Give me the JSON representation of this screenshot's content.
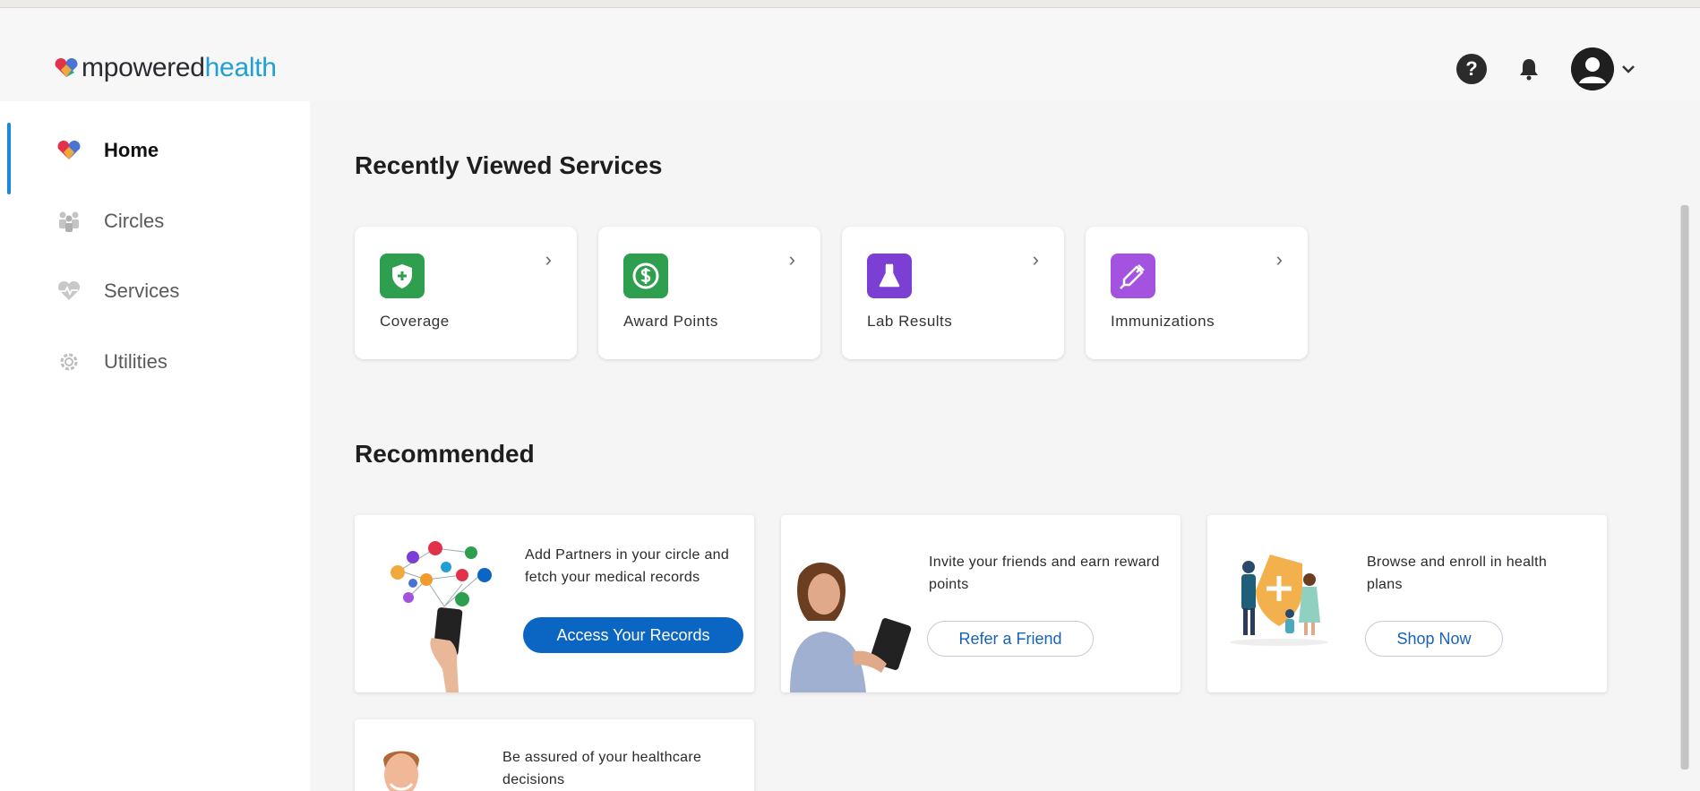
{
  "brand": {
    "part1": "mpowered",
    "part2": "health",
    "heart_colors": [
      "#e0334b",
      "#f2a93b",
      "#4a74d4",
      "#27a88e"
    ]
  },
  "header": {
    "help_glyph": "?",
    "icons": [
      "help-icon",
      "bell-icon",
      "user-avatar-icon",
      "chevron-down-icon"
    ]
  },
  "sidebar": {
    "items": [
      {
        "label": "Home",
        "icon": "heart-logo-icon",
        "active": true
      },
      {
        "label": "Circles",
        "icon": "people-icon",
        "active": false
      },
      {
        "label": "Services",
        "icon": "heart-pulse-icon",
        "active": false
      },
      {
        "label": "Utilities",
        "icon": "gear-icon",
        "active": false
      }
    ],
    "accent": "#1a8ad8"
  },
  "recent": {
    "title": "Recently Viewed Services",
    "arrow": "›",
    "items": [
      {
        "label": "Coverage",
        "icon": "shield-plus-icon",
        "color": "#2e9e4f"
      },
      {
        "label": "Award Points",
        "icon": "dollar-icon",
        "color": "#2e9e4f"
      },
      {
        "label": "Lab Results",
        "icon": "flask-icon",
        "color": "#7b3fd4"
      },
      {
        "label": "Immunizations",
        "icon": "syringe-icon",
        "color": "#a353e0"
      }
    ]
  },
  "recommended": {
    "title": "Recommended",
    "cards": [
      {
        "text": "Add Partners in your circle and fetch your medical records",
        "button": "Access Your Records",
        "style": "primary"
      },
      {
        "text": "Invite your friends and earn reward points",
        "button": "Refer a Friend",
        "style": "outline"
      },
      {
        "text": "Browse and enroll in health plans",
        "button": "Shop Now",
        "style": "outline"
      },
      {
        "text": "Be assured of your healthcare decisions"
      }
    ]
  },
  "colors": {
    "primary_button": "#0b66c3",
    "link_blue": "#1763b8"
  }
}
